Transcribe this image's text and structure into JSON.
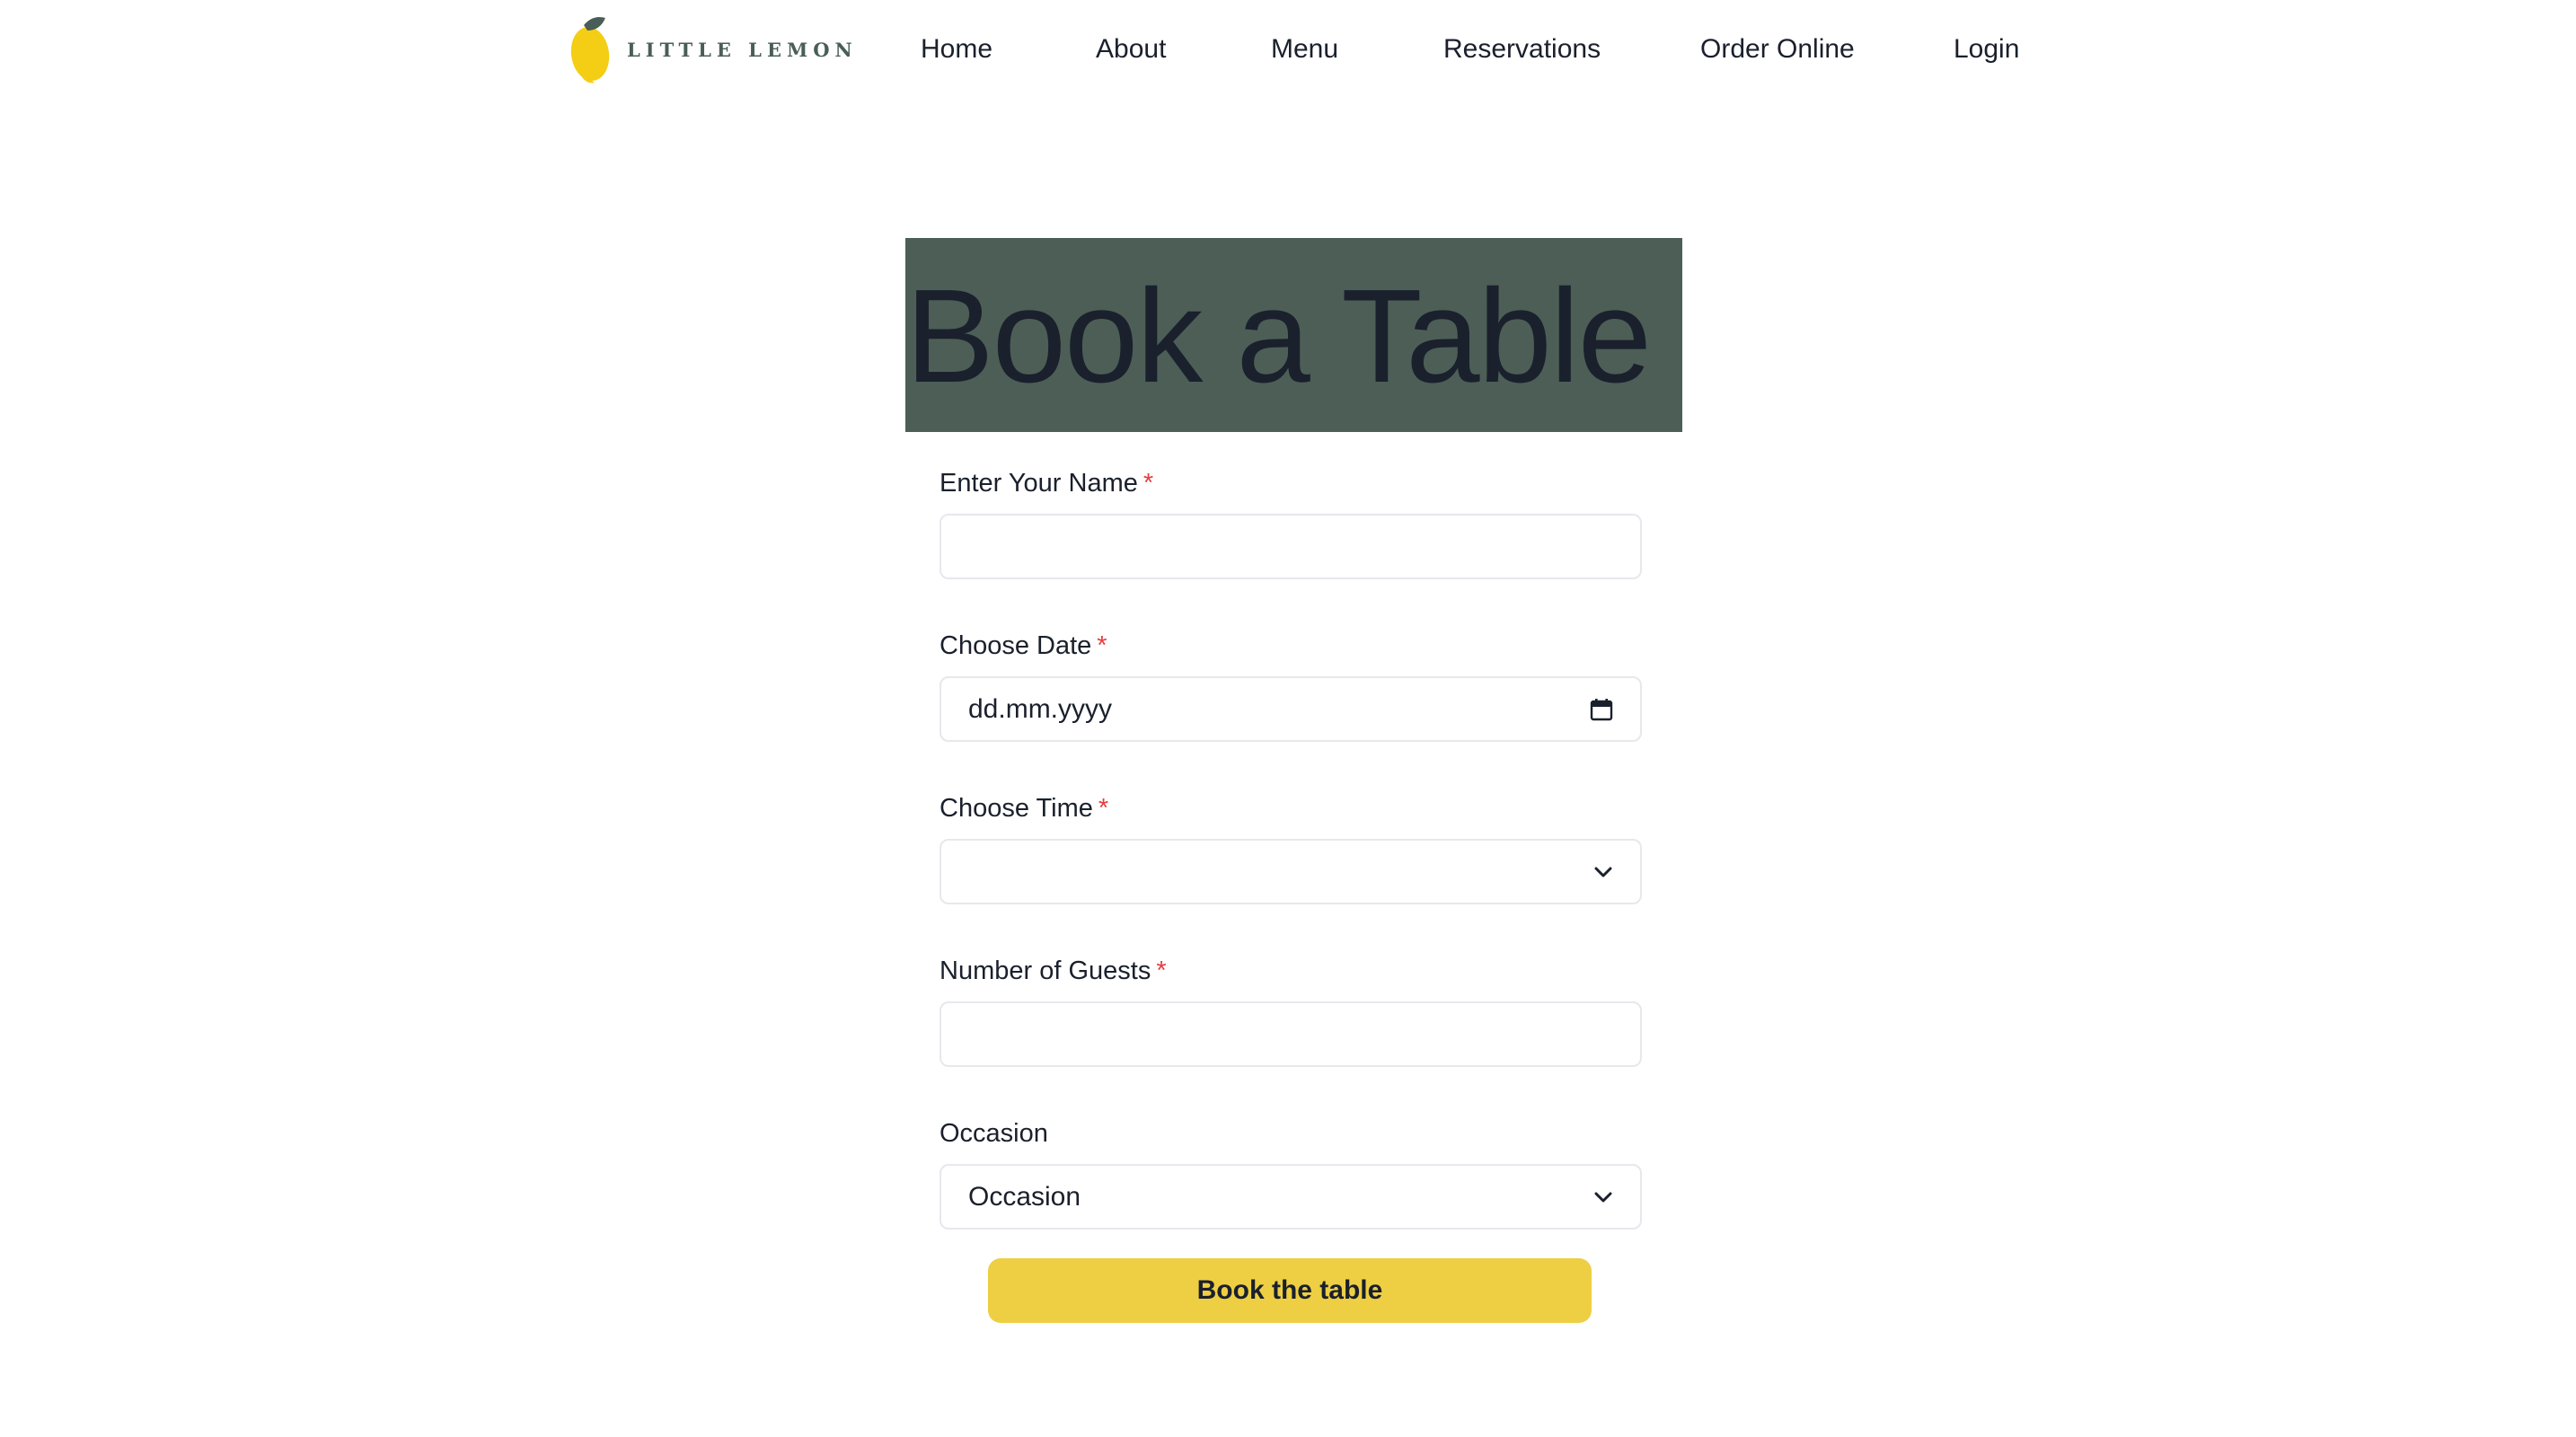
{
  "brand": {
    "name": "LITTLE LEMON",
    "colors": {
      "primary": "#495e57",
      "accent": "#eecf43",
      "required": "#e53e3e"
    }
  },
  "nav": {
    "items": [
      {
        "label": "Home"
      },
      {
        "label": "About"
      },
      {
        "label": "Menu"
      },
      {
        "label": "Reservations"
      },
      {
        "label": "Order Online"
      },
      {
        "label": "Login"
      }
    ]
  },
  "hero": {
    "title": "Book a Table"
  },
  "form": {
    "required_mark": "*",
    "name": {
      "label": "Enter Your Name",
      "value": ""
    },
    "date": {
      "label": "Choose Date",
      "placeholder": "dd.mm.yyyy",
      "icon": "calendar-icon"
    },
    "time": {
      "label": "Choose Time",
      "selected": "",
      "icon": "chevron-down-icon"
    },
    "guests": {
      "label": "Number of Guests",
      "value": ""
    },
    "occasion": {
      "label": "Occasion",
      "selected": "Occasion",
      "icon": "chevron-down-icon"
    },
    "submit_label": "Book the table"
  }
}
